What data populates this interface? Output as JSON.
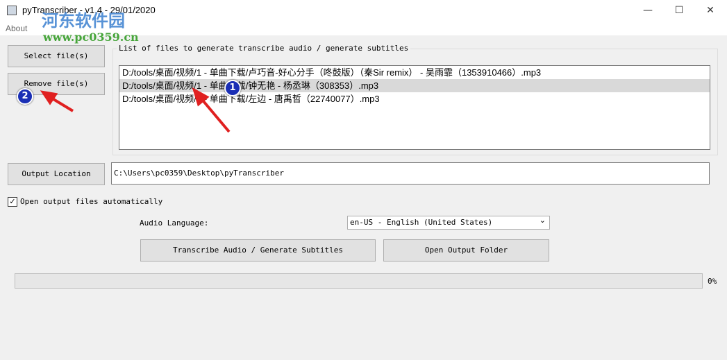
{
  "window": {
    "title": "pyTranscriber - v1.4 - 29/01/2020",
    "minimize": "—",
    "maximize": "☐",
    "close": "✕"
  },
  "menu": {
    "about": "About"
  },
  "watermark": {
    "name": "河东软件园",
    "url": "www.pc0359.cn"
  },
  "buttons": {
    "select_files": "Select file(s)",
    "remove_files": "Remove file(s)",
    "output_location": "Output Location",
    "transcribe": "Transcribe Audio / Generate Subtitles",
    "open_output_folder": "Open Output Folder"
  },
  "file_list": {
    "label": "List of files to generate transcribe audio / generate subtitles",
    "items": [
      "D:/tools/桌面/视频/1 - 单曲下载/卢巧音-好心分手（咚鼓版）（秦Sir remix） - 吴雨霏（1353910466）.mp3",
      "D:/tools/桌面/视频/1 - 单曲下载/钟无艳 - 杨丞琳（308353）.mp3",
      "D:/tools/桌面/视频/1 - 单曲下载/左边 - 唐禹哲（22740077）.mp3"
    ],
    "selected_index": 1
  },
  "output_path": "C:\\Users\\pc0359\\Desktop\\pyTranscriber",
  "open_auto": {
    "label": "Open output files automatically",
    "checked": true,
    "check": "✓"
  },
  "language": {
    "label": "Audio Language:",
    "value": "en-US - English (United States)",
    "arrow": "⌄"
  },
  "progress": {
    "value": 0,
    "text": "0%"
  },
  "annotations": {
    "one": "1",
    "two": "2"
  }
}
